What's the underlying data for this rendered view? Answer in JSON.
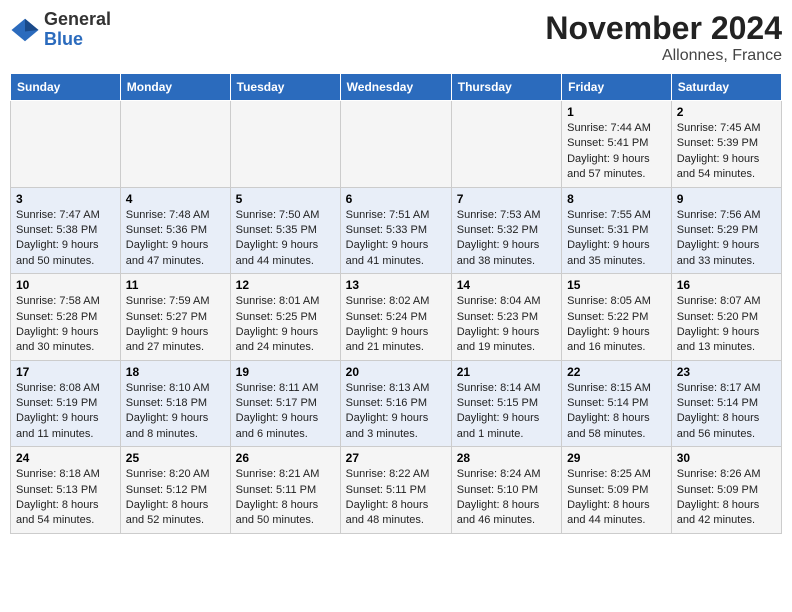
{
  "header": {
    "logo_general": "General",
    "logo_blue": "Blue",
    "month": "November 2024",
    "location": "Allonnes, France"
  },
  "weekdays": [
    "Sunday",
    "Monday",
    "Tuesday",
    "Wednesday",
    "Thursday",
    "Friday",
    "Saturday"
  ],
  "weeks": [
    [
      {
        "day": "",
        "info": ""
      },
      {
        "day": "",
        "info": ""
      },
      {
        "day": "",
        "info": ""
      },
      {
        "day": "",
        "info": ""
      },
      {
        "day": "",
        "info": ""
      },
      {
        "day": "1",
        "info": "Sunrise: 7:44 AM\nSunset: 5:41 PM\nDaylight: 9 hours and 57 minutes."
      },
      {
        "day": "2",
        "info": "Sunrise: 7:45 AM\nSunset: 5:39 PM\nDaylight: 9 hours and 54 minutes."
      }
    ],
    [
      {
        "day": "3",
        "info": "Sunrise: 7:47 AM\nSunset: 5:38 PM\nDaylight: 9 hours and 50 minutes."
      },
      {
        "day": "4",
        "info": "Sunrise: 7:48 AM\nSunset: 5:36 PM\nDaylight: 9 hours and 47 minutes."
      },
      {
        "day": "5",
        "info": "Sunrise: 7:50 AM\nSunset: 5:35 PM\nDaylight: 9 hours and 44 minutes."
      },
      {
        "day": "6",
        "info": "Sunrise: 7:51 AM\nSunset: 5:33 PM\nDaylight: 9 hours and 41 minutes."
      },
      {
        "day": "7",
        "info": "Sunrise: 7:53 AM\nSunset: 5:32 PM\nDaylight: 9 hours and 38 minutes."
      },
      {
        "day": "8",
        "info": "Sunrise: 7:55 AM\nSunset: 5:31 PM\nDaylight: 9 hours and 35 minutes."
      },
      {
        "day": "9",
        "info": "Sunrise: 7:56 AM\nSunset: 5:29 PM\nDaylight: 9 hours and 33 minutes."
      }
    ],
    [
      {
        "day": "10",
        "info": "Sunrise: 7:58 AM\nSunset: 5:28 PM\nDaylight: 9 hours and 30 minutes."
      },
      {
        "day": "11",
        "info": "Sunrise: 7:59 AM\nSunset: 5:27 PM\nDaylight: 9 hours and 27 minutes."
      },
      {
        "day": "12",
        "info": "Sunrise: 8:01 AM\nSunset: 5:25 PM\nDaylight: 9 hours and 24 minutes."
      },
      {
        "day": "13",
        "info": "Sunrise: 8:02 AM\nSunset: 5:24 PM\nDaylight: 9 hours and 21 minutes."
      },
      {
        "day": "14",
        "info": "Sunrise: 8:04 AM\nSunset: 5:23 PM\nDaylight: 9 hours and 19 minutes."
      },
      {
        "day": "15",
        "info": "Sunrise: 8:05 AM\nSunset: 5:22 PM\nDaylight: 9 hours and 16 minutes."
      },
      {
        "day": "16",
        "info": "Sunrise: 8:07 AM\nSunset: 5:20 PM\nDaylight: 9 hours and 13 minutes."
      }
    ],
    [
      {
        "day": "17",
        "info": "Sunrise: 8:08 AM\nSunset: 5:19 PM\nDaylight: 9 hours and 11 minutes."
      },
      {
        "day": "18",
        "info": "Sunrise: 8:10 AM\nSunset: 5:18 PM\nDaylight: 9 hours and 8 minutes."
      },
      {
        "day": "19",
        "info": "Sunrise: 8:11 AM\nSunset: 5:17 PM\nDaylight: 9 hours and 6 minutes."
      },
      {
        "day": "20",
        "info": "Sunrise: 8:13 AM\nSunset: 5:16 PM\nDaylight: 9 hours and 3 minutes."
      },
      {
        "day": "21",
        "info": "Sunrise: 8:14 AM\nSunset: 5:15 PM\nDaylight: 9 hours and 1 minute."
      },
      {
        "day": "22",
        "info": "Sunrise: 8:15 AM\nSunset: 5:14 PM\nDaylight: 8 hours and 58 minutes."
      },
      {
        "day": "23",
        "info": "Sunrise: 8:17 AM\nSunset: 5:14 PM\nDaylight: 8 hours and 56 minutes."
      }
    ],
    [
      {
        "day": "24",
        "info": "Sunrise: 8:18 AM\nSunset: 5:13 PM\nDaylight: 8 hours and 54 minutes."
      },
      {
        "day": "25",
        "info": "Sunrise: 8:20 AM\nSunset: 5:12 PM\nDaylight: 8 hours and 52 minutes."
      },
      {
        "day": "26",
        "info": "Sunrise: 8:21 AM\nSunset: 5:11 PM\nDaylight: 8 hours and 50 minutes."
      },
      {
        "day": "27",
        "info": "Sunrise: 8:22 AM\nSunset: 5:11 PM\nDaylight: 8 hours and 48 minutes."
      },
      {
        "day": "28",
        "info": "Sunrise: 8:24 AM\nSunset: 5:10 PM\nDaylight: 8 hours and 46 minutes."
      },
      {
        "day": "29",
        "info": "Sunrise: 8:25 AM\nSunset: 5:09 PM\nDaylight: 8 hours and 44 minutes."
      },
      {
        "day": "30",
        "info": "Sunrise: 8:26 AM\nSunset: 5:09 PM\nDaylight: 8 hours and 42 minutes."
      }
    ]
  ]
}
